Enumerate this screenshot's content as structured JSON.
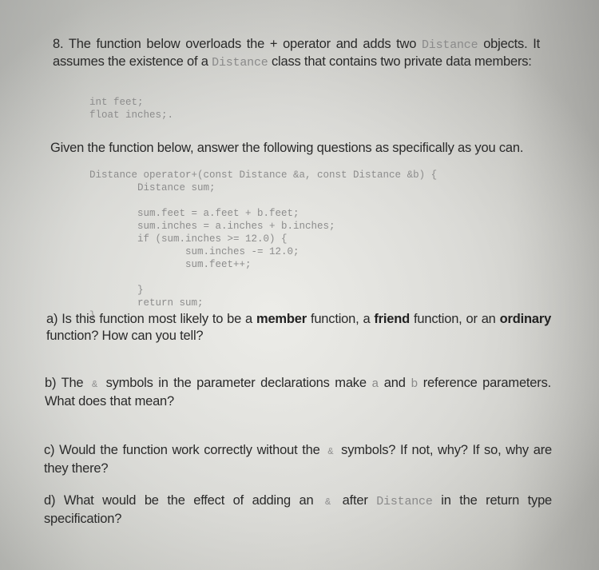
{
  "question": {
    "number": "8.",
    "intro": {
      "part1": "The function below overloads the + operator and adds two",
      "class_name": "Distance",
      "part2": "objects. It assumes the existence of a",
      "class_name_2": "Distance",
      "part3": "class that contains two private data members:"
    },
    "data_members": [
      "int feet;",
      "float inches;."
    ],
    "instruction": "Given the function below, answer the following questions as specifically as you can.",
    "code_lines": [
      "Distance operator+(const Distance &a, const Distance &b) {",
      "        Distance sum;",
      "",
      "        sum.feet = a.feet + b.feet;",
      "        sum.inches = a.inches + b.inches;",
      "        if (sum.inches >= 12.0) {",
      "                sum.inches -= 12.0;",
      "                sum.feet++;",
      "        }",
      "        return sum;",
      "}"
    ],
    "parts": {
      "a": {
        "label": "a)",
        "t1": "Is this function most likely to be a",
        "b1": "member",
        "t2": "function, a",
        "b2": "friend",
        "t3": "function, or an",
        "b3": "ordinary",
        "t4": "function? How can you tell?"
      },
      "b": {
        "label": "b)",
        "t1": "The",
        "amp": "&",
        "t2": "symbols in the parameter declarations make",
        "var_a": "a",
        "t3": "and",
        "var_b": "b",
        "t4": "reference parameters. What does that mean?"
      },
      "c": {
        "label": "c)",
        "t1": "Would the function work correctly without the",
        "amp": "&",
        "t2": "symbols? If not, why? If so, why are they there?"
      },
      "d": {
        "label": "d)",
        "t1": "What would be the effect of adding an",
        "amp": "&",
        "t2": "after",
        "class_name": "Distance",
        "t3": "in the return type specification?"
      }
    }
  }
}
